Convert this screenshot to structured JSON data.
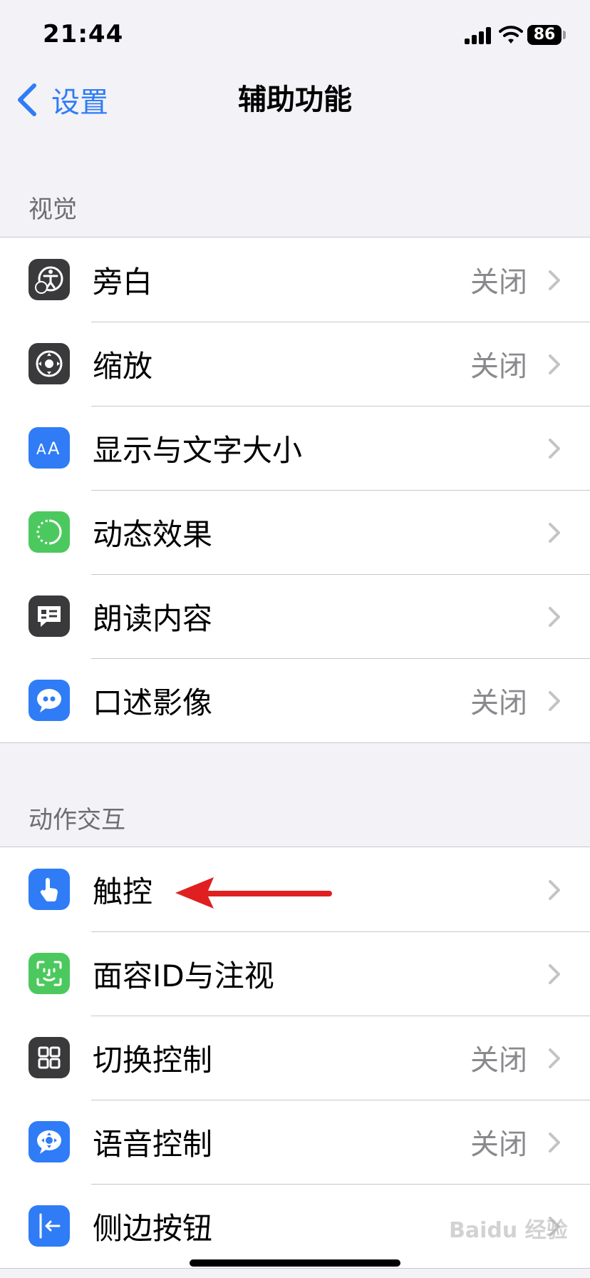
{
  "status_bar": {
    "time": "21:44",
    "battery": "86"
  },
  "nav": {
    "back_label": "设置",
    "title": "辅助功能"
  },
  "sections": [
    {
      "header": "视觉",
      "rows": [
        {
          "label": "旁白",
          "value": "关闭",
          "icon": "voiceover-icon",
          "color": "#3a3a3c"
        },
        {
          "label": "缩放",
          "value": "关闭",
          "icon": "zoom-icon",
          "color": "#3a3a3c"
        },
        {
          "label": "显示与文字大小",
          "value": "",
          "icon": "text-size-icon",
          "color": "#2f7cf6"
        },
        {
          "label": "动态效果",
          "value": "",
          "icon": "motion-icon",
          "color": "#4cc95e"
        },
        {
          "label": "朗读内容",
          "value": "",
          "icon": "spoken-content-icon",
          "color": "#3a3a3c"
        },
        {
          "label": "口述影像",
          "value": "关闭",
          "icon": "audio-description-icon",
          "color": "#2f7cf6"
        }
      ]
    },
    {
      "header": "动作交互",
      "rows": [
        {
          "label": "触控",
          "value": "",
          "icon": "touch-icon",
          "color": "#2f7cf6"
        },
        {
          "label": "面容ID与注视",
          "value": "",
          "icon": "face-id-icon",
          "color": "#4cc95e"
        },
        {
          "label": "切换控制",
          "value": "关闭",
          "icon": "switch-control-icon",
          "color": "#3a3a3c"
        },
        {
          "label": "语音控制",
          "value": "关闭",
          "icon": "voice-control-icon",
          "color": "#2f7cf6"
        },
        {
          "label": "侧边按钮",
          "value": "",
          "icon": "side-button-icon",
          "color": "#2f7cf6"
        }
      ]
    }
  ],
  "annotation": {
    "arrow_color": "#e02020"
  },
  "watermark": "Baidu 经验"
}
